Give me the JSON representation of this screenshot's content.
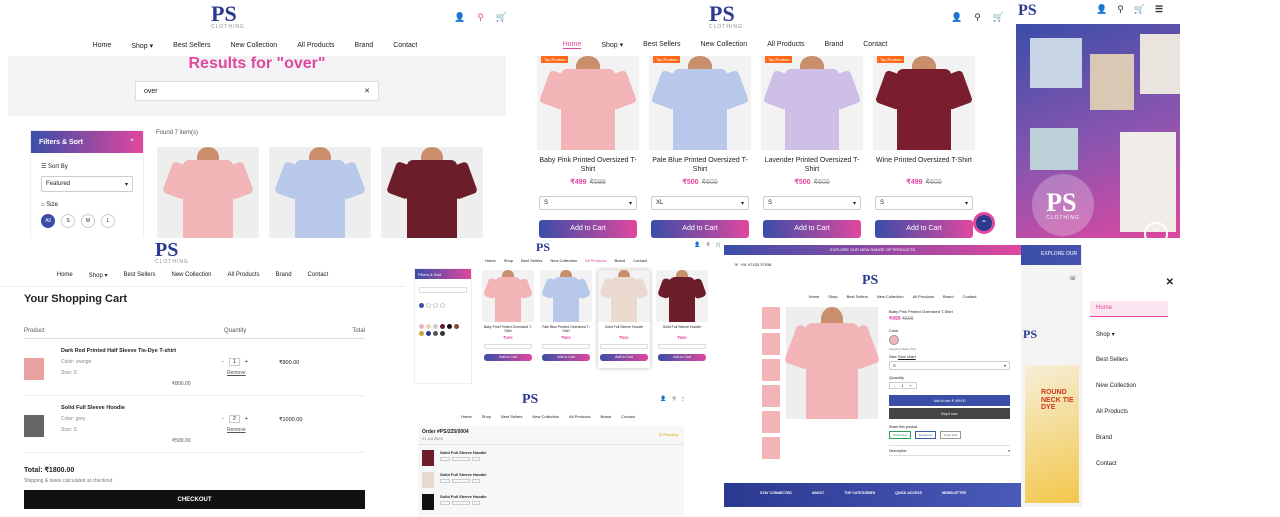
{
  "brand": {
    "logo_text": "PS",
    "logo_sub": "CLOTHING"
  },
  "nav": {
    "home": "Home",
    "shop": "Shop",
    "best": "Best Sellers",
    "newc": "New Collection",
    "all": "All Products",
    "brand": "Brand",
    "contact": "Contact"
  },
  "search_panel": {
    "heading": "Results for \"over\"",
    "search_value": "over",
    "found": "Found 7 item(s)",
    "filter_title": "Filters & Sort",
    "sort_by": "Sort By",
    "sort_value": "Featured",
    "size": "Size",
    "sizes": [
      "All",
      "S",
      "M",
      "L"
    ]
  },
  "product_panel": {
    "products": [
      {
        "title": "Baby Pink Printed Oversized T-Shirt",
        "price": "₹499",
        "mrp": "₹599",
        "size": "S",
        "tag": "Top Product",
        "color": "#f2b4b7"
      },
      {
        "title": "Pale Blue Printed Oversized T-Shirt",
        "price": "₹500",
        "mrp": "₹600",
        "size": "XL",
        "tag": "Top Product",
        "color": "#b7c8ea"
      },
      {
        "title": "Lavender Printed Oversized T-Shirt",
        "price": "₹500",
        "mrp": "₹600",
        "size": "S",
        "tag": "Top Product",
        "color": "#cdbfe6"
      },
      {
        "title": "Wine Printed Oversized T-Shirt",
        "price": "₹499",
        "mrp": "₹600",
        "size": "S",
        "tag": "Top Product",
        "color": "#7a1d2c"
      }
    ],
    "add_label": "Add to Cart"
  },
  "cart": {
    "title": "Your Shopping Cart",
    "col_product": "Product",
    "col_qty": "Quantity",
    "col_total": "Total",
    "items": [
      {
        "name": "Dark Red Printed Half Sleeve Tie-Dye T-shirt",
        "color": "Color: orange",
        "size": "Size: S",
        "unit": "₹800.00",
        "qty": "1",
        "line": "₹800.00",
        "remove": "Remove"
      },
      {
        "name": "Solid Full Sleeve Hoodie",
        "color": "Color: grey",
        "size": "Size: S",
        "unit": "₹500.00",
        "qty": "2",
        "line": "₹1000.00",
        "remove": "Remove"
      }
    ],
    "total": "Total: ₹1800.00",
    "note": "Shipping & taxes calculated at checkout",
    "checkout": "CHECKOUT"
  },
  "mini_listing": {
    "filter_title": "Filters & Sort",
    "products": [
      {
        "title": "Baby Pink Printed Oversized T-Shirt",
        "price": "₹499",
        "color": "#f2b4b7"
      },
      {
        "title": "Pale Blue Printed Oversized T-Shirt",
        "price": "₹500",
        "color": "#b7c8ea"
      },
      {
        "title": "Solid Full Sleeve Hoodie",
        "price": "₹500",
        "color": "#e9d9cf"
      },
      {
        "title": "Solid Full Sleeve Hoodie",
        "price": "₹550",
        "color": "#6b1d2a"
      }
    ],
    "add_label": "Add to Cart"
  },
  "order": {
    "id": "Order #PS/225/0004",
    "date": "21 Jul 2025",
    "status": "Pending",
    "items": [
      "Solid Full Sleeve Hoodie",
      "Solid Full Sleeve Hoodie",
      "Solid Full Sleeve Hoodie"
    ]
  },
  "detail": {
    "promo": "EXPLORE OUR NEW RANGE OF PRODUCTS",
    "phone": "+91 97433 37938",
    "title": "Baby Pink Printed Oversized T-Shirt",
    "price": "₹499",
    "mrp": "₹599",
    "color_label": "Color",
    "selected": "Selected: Baby Pink",
    "size_label": "Size",
    "size_chart": "Size chart",
    "qty_label": "Quantity",
    "qty": "1",
    "add": "Add to cart ₹ 499.00",
    "buy": "Buy it now",
    "share": "Share this product",
    "share_btns": [
      "WhatsApp",
      "Facebook",
      "Copy Link"
    ],
    "desc": "Description",
    "footer": [
      "STAY CONNECTED",
      "ABOUT",
      "TOP CATEGORIES",
      "QUICK ACCESS",
      "NEWSLETTER"
    ]
  },
  "mobile_menu": {
    "promo": "EXPLORE OUR",
    "items": [
      "Home",
      "Shop",
      "Best Sellers",
      "New Collection",
      "All Products",
      "Brand",
      "Contact"
    ],
    "banner": "ROUND NECK TIE DYE"
  },
  "colors": {
    "accent": "#e0479e",
    "navy": "#2b3990"
  }
}
